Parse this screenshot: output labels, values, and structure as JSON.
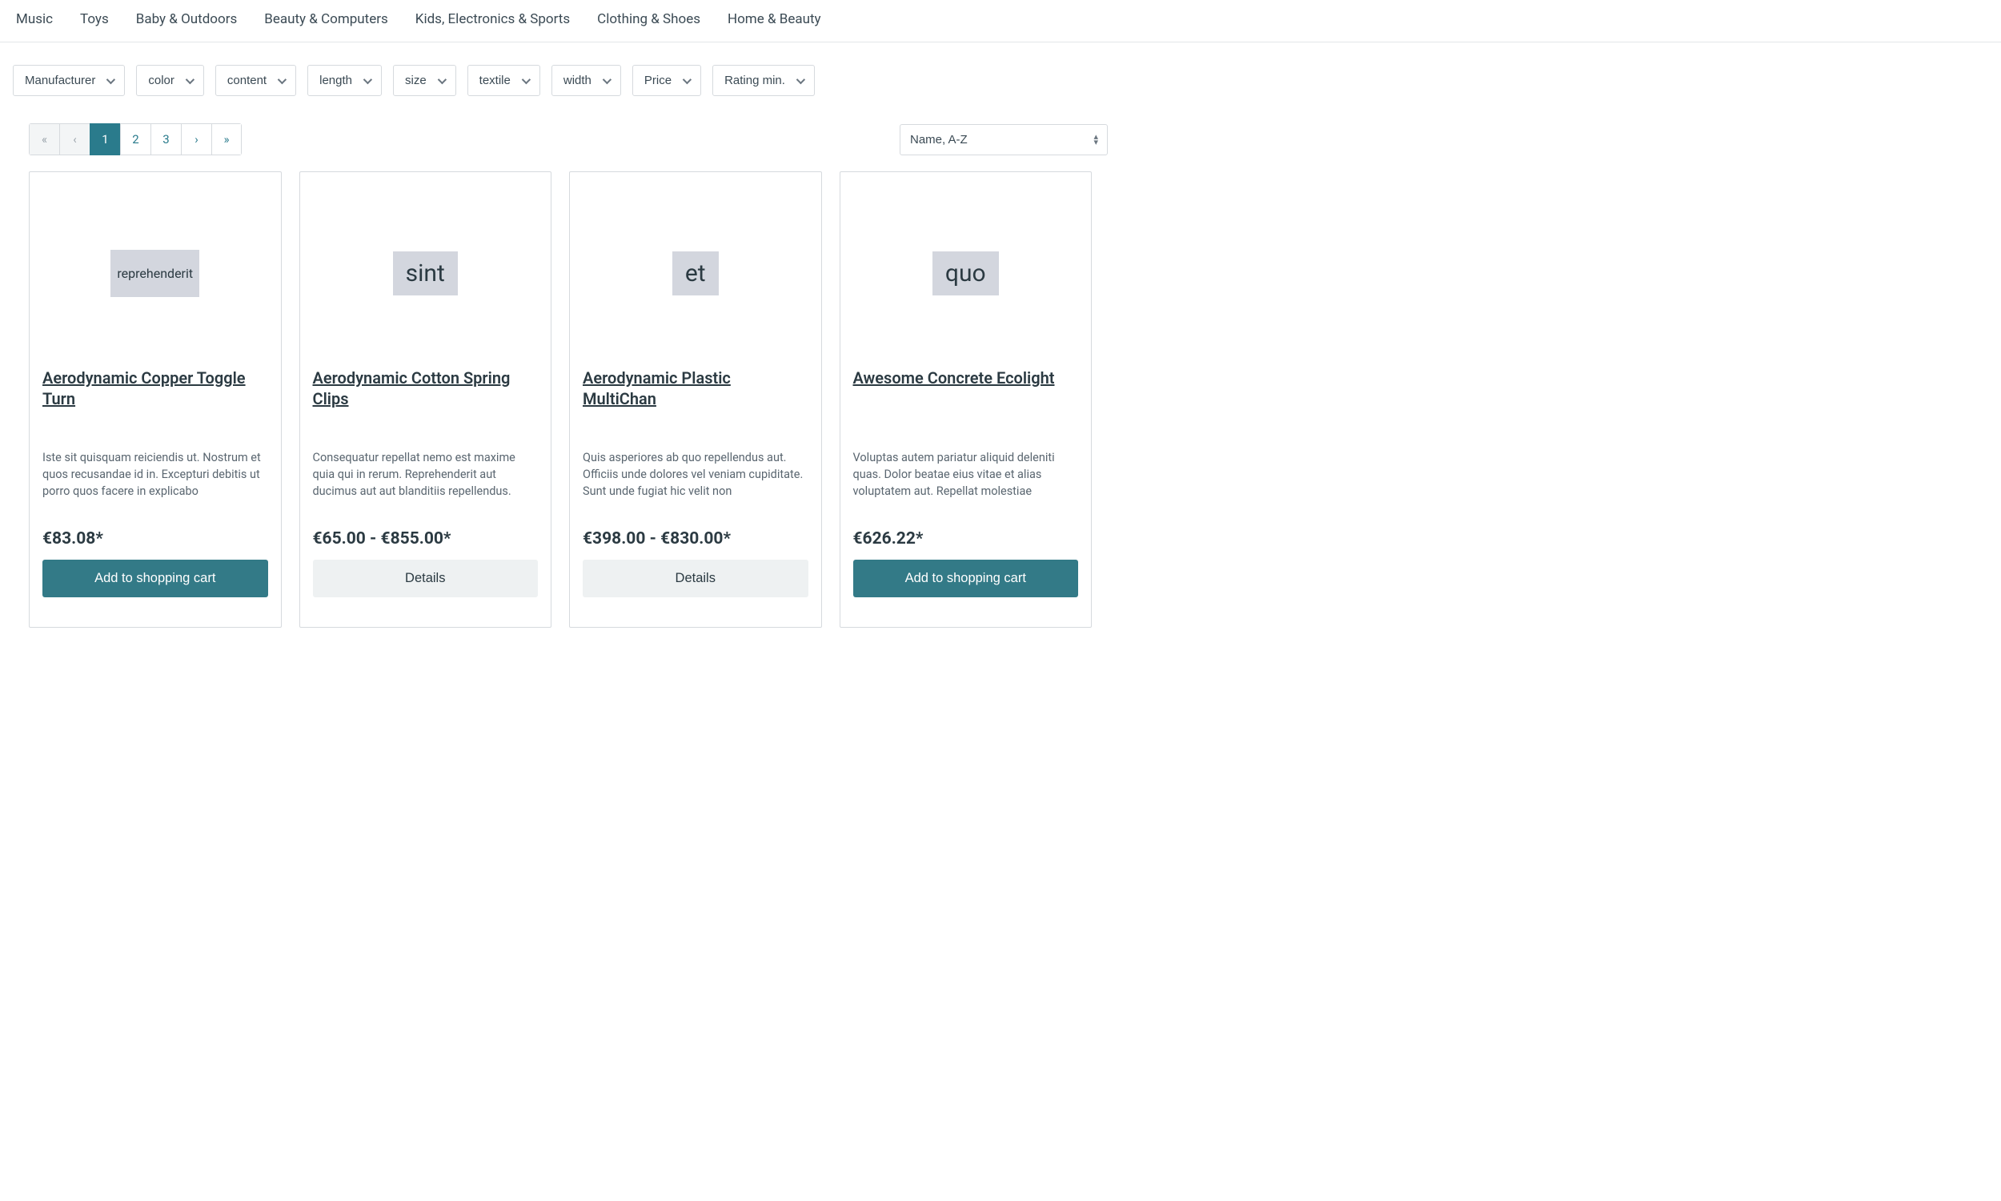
{
  "nav": {
    "items": [
      "Music",
      "Toys",
      "Baby & Outdoors",
      "Beauty & Computers",
      "Kids, Electronics & Sports",
      "Clothing & Shoes",
      "Home & Beauty"
    ]
  },
  "filters": [
    {
      "label": "Manufacturer"
    },
    {
      "label": "color"
    },
    {
      "label": "content"
    },
    {
      "label": "length"
    },
    {
      "label": "size"
    },
    {
      "label": "textile"
    },
    {
      "label": "width"
    },
    {
      "label": "Price"
    },
    {
      "label": "Rating min."
    }
  ],
  "pagination": {
    "first": "«",
    "prev": "‹",
    "pages": [
      "1",
      "2",
      "3"
    ],
    "current": "1",
    "next": "›",
    "last": "»"
  },
  "sort": {
    "selected": "Name, A-Z"
  },
  "products": [
    {
      "thumb_text": "reprehenderit",
      "thumb_size": "small",
      "title": "Aerodynamic Copper Toggle Turn",
      "desc": "Iste sit quisquam reiciendis ut. Nostrum et quos recusandae id in. Excepturi debitis ut porro quos facere in explicabo",
      "price": "€83.08*",
      "action_label": "Add to shopping cart",
      "action_type": "primary"
    },
    {
      "thumb_text": "sint",
      "thumb_size": "large",
      "title": "Aerodynamic Cotton Spring Clips",
      "desc": "Consequatur repellat nemo est maxime quia qui in rerum. Reprehenderit aut ducimus aut aut blanditiis repellendus.",
      "price": "€65.00 - €855.00*",
      "action_label": "Details",
      "action_type": "secondary"
    },
    {
      "thumb_text": "et",
      "thumb_size": "large",
      "title": "Aerodynamic Plastic MultiChan",
      "desc": "Quis asperiores ab quo repellendus aut. Officiis unde dolores vel veniam cupiditate. Sunt unde fugiat hic velit non",
      "price": "€398.00 - €830.00*",
      "action_label": "Details",
      "action_type": "secondary"
    },
    {
      "thumb_text": "quo",
      "thumb_size": "large",
      "title": "Awesome Concrete Ecolight",
      "desc": "Voluptas autem pariatur aliquid deleniti quas. Dolor beatae eius vitae et alias voluptatem aut. Repellat molestiae",
      "price": "€626.22*",
      "action_label": "Add to shopping cart",
      "action_type": "primary"
    }
  ]
}
